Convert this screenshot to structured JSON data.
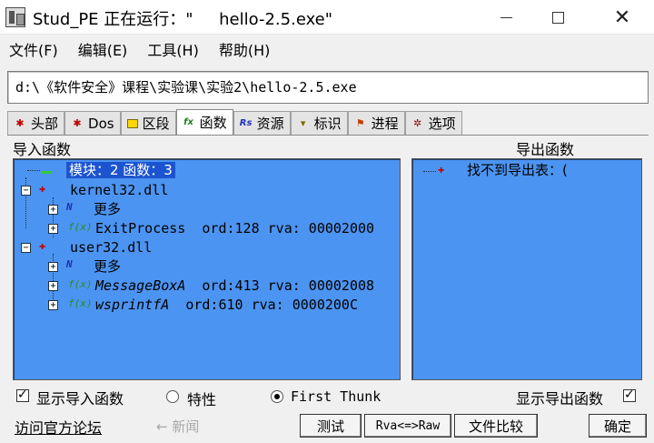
{
  "window": {
    "title": "Stud_PE 正在运行：\"     hello-2.5.exe\"",
    "minimize_label": "minimize",
    "maximize_label": "maximize",
    "close_label": "✕"
  },
  "menu": {
    "items": [
      "文件(F)",
      "编辑(E)",
      "工具(H)",
      "帮助(H)"
    ]
  },
  "path": "d:\\《软件安全》课程\\实验课\\实验2\\hello-2.5.exe",
  "tabs": [
    {
      "label": "头部",
      "icon": "red-star-icon"
    },
    {
      "label": "Dos",
      "icon": "red-star-icon"
    },
    {
      "label": "区段",
      "icon": "folder-icon"
    },
    {
      "label": "函数",
      "icon": "fx-icon",
      "active": true
    },
    {
      "label": "资源",
      "icon": "rs-icon"
    },
    {
      "label": "标识",
      "icon": "pin-icon"
    },
    {
      "label": "进程",
      "icon": "flag-icon"
    },
    {
      "label": "选项",
      "icon": "gear-icon"
    }
  ],
  "import_panel": {
    "label": "导入函数",
    "root": "模块：2 函数：3",
    "modules": [
      {
        "name": "kernel32.dll",
        "more": "更多",
        "functions": [
          {
            "name": "ExitProcess",
            "ord": "ord:128",
            "rva": "rva: 00002000"
          }
        ]
      },
      {
        "name": "user32.dll",
        "more": "更多",
        "functions": [
          {
            "name": "MessageBoxA",
            "ord": "ord:413",
            "rva": "rva: 00002008"
          },
          {
            "name": "wsprintfA",
            "ord": "ord:610",
            "rva": "rva: 0000200C"
          }
        ]
      }
    ]
  },
  "export_panel": {
    "label": "导出函数",
    "item": "找不到导出表：("
  },
  "options": {
    "show_imports": "显示导入函数",
    "show_imports_checked": true,
    "radio_traits": "特性",
    "radio_first_thunk": "First Thunk",
    "radio_selected": "first_thunk",
    "show_exports": "显示导出函数",
    "show_exports_checked": true
  },
  "bottom": {
    "forum_link": "访问官方论坛",
    "back_label": "← 新闻",
    "test_button": "测试",
    "rva_raw_button": "Rva<=>Raw",
    "compare_button": "文件比较",
    "ok_button": "确定"
  },
  "colors": {
    "panel_bg": "#4c94f1",
    "selection": "#1c54d0"
  }
}
